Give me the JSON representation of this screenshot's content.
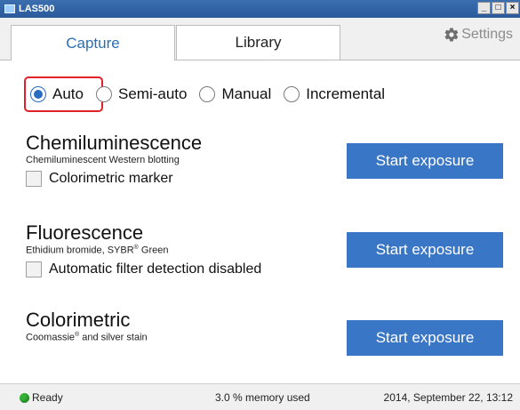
{
  "window": {
    "title": "LAS500",
    "controls": [
      "_",
      "□",
      "×"
    ]
  },
  "tabs": [
    {
      "label": "Capture",
      "active": true
    },
    {
      "label": "Library",
      "active": false
    }
  ],
  "settings": {
    "label": "Settings",
    "icon": "gear-icon"
  },
  "mode": {
    "options": [
      "Auto",
      "Semi-auto",
      "Manual",
      "Incremental"
    ],
    "selected": "Auto"
  },
  "sections": [
    {
      "heading": "Chemiluminescence",
      "sub": "Chemiluminescent Western blotting",
      "checkbox": "Colorimetric marker",
      "button": "Start exposure"
    },
    {
      "heading": "Fluorescence",
      "sub_before": "Ethidium bromide, SYBR",
      "sub_sup": "®",
      "sub_after": " Green",
      "checkbox": "Automatic filter detection disabled",
      "button": "Start exposure"
    },
    {
      "heading": "Colorimetric",
      "sub_before": "Coomassie",
      "sub_sup": "®",
      "sub_after": " and silver stain",
      "button": "Start exposure"
    }
  ],
  "status": {
    "ready": "Ready",
    "memory": "3.0 % memory used",
    "datetime": "2014, September 22, 13:12"
  },
  "colors": {
    "accent": "#3a76c6",
    "tab_active_text": "#2b6fb3",
    "highlight": "#e0202a",
    "ready_dot": "#35b335"
  }
}
